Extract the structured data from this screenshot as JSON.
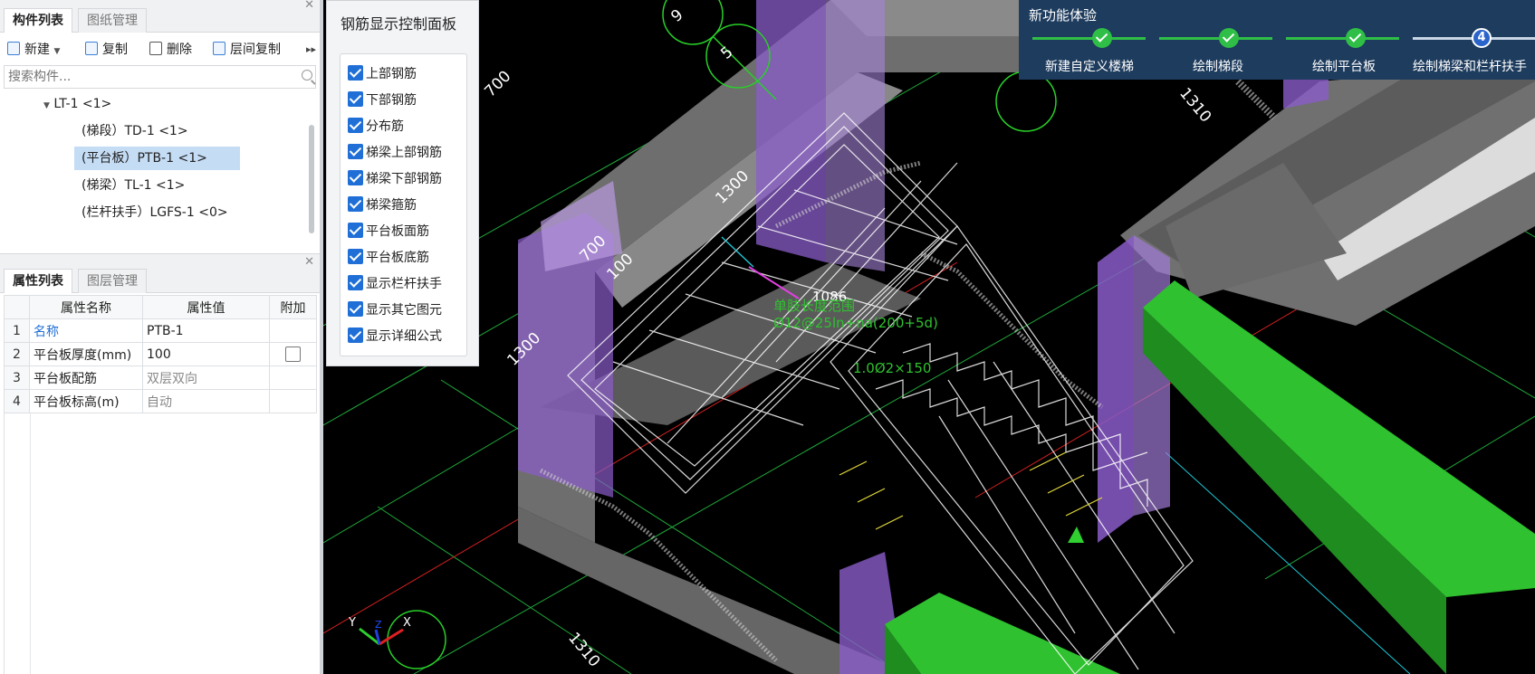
{
  "component_panel": {
    "tabs": [
      "构件列表",
      "图纸管理"
    ],
    "toolbar": {
      "new": "新建",
      "copy": "复制",
      "delete": "删除",
      "floor_copy": "层间复制"
    },
    "search_placeholder": "搜索构件...",
    "tree": [
      {
        "label": "LT-1 <1>"
      },
      {
        "label": "(梯段）TD-1 <1>"
      },
      {
        "label": "(平台板）PTB-1 <1>"
      },
      {
        "label": "(梯梁）TL-1 <1>"
      },
      {
        "label": "(栏杆扶手）LGFS-1 <0>"
      }
    ]
  },
  "property_panel": {
    "tabs": [
      "属性列表",
      "图层管理"
    ],
    "headers": [
      "属性名称",
      "属性值",
      "附加"
    ],
    "rows": [
      {
        "num": "1",
        "name": "名称",
        "value": "PTB-1"
      },
      {
        "num": "2",
        "name": "平台板厚度(mm)",
        "value": "100"
      },
      {
        "num": "3",
        "name": "平台板配筋",
        "value": "双层双向"
      },
      {
        "num": "4",
        "name": "平台板标高(m)",
        "value": "自动"
      }
    ]
  },
  "rebar_panel": {
    "title": "钢筋显示控制面板",
    "options": [
      "上部钢筋",
      "下部钢筋",
      "分布筋",
      "梯梁上部钢筋",
      "梯梁下部钢筋",
      "梯梁箍筋",
      "平台板面筋",
      "平台板底筋",
      "显示栏杆扶手",
      "显示其它图元",
      "显示详细公式"
    ]
  },
  "guide": {
    "title": "新功能体验",
    "steps": [
      "新建自定义楼梯",
      "绘制梯段",
      "绘制平台板",
      "绘制梯梁和栏杆扶手"
    ],
    "current_step": "4"
  },
  "viewport": {
    "dims": [
      "1310",
      "1300",
      "700",
      "100",
      "1300",
      "700",
      "1310",
      "1086"
    ],
    "axis_labels": [
      "9",
      "5",
      "Y",
      "Z",
      "X"
    ],
    "annotation_1": "单肢长度范围",
    "annotation_2": "Ø12@25ln+na(200+5d)",
    "annotation_3": "1.0Ø2×150",
    "colors": {
      "purple": "#8a5cc9",
      "green": "#2fc12f",
      "gray": "#7d7d7d",
      "rebar": "#ffffff"
    }
  }
}
